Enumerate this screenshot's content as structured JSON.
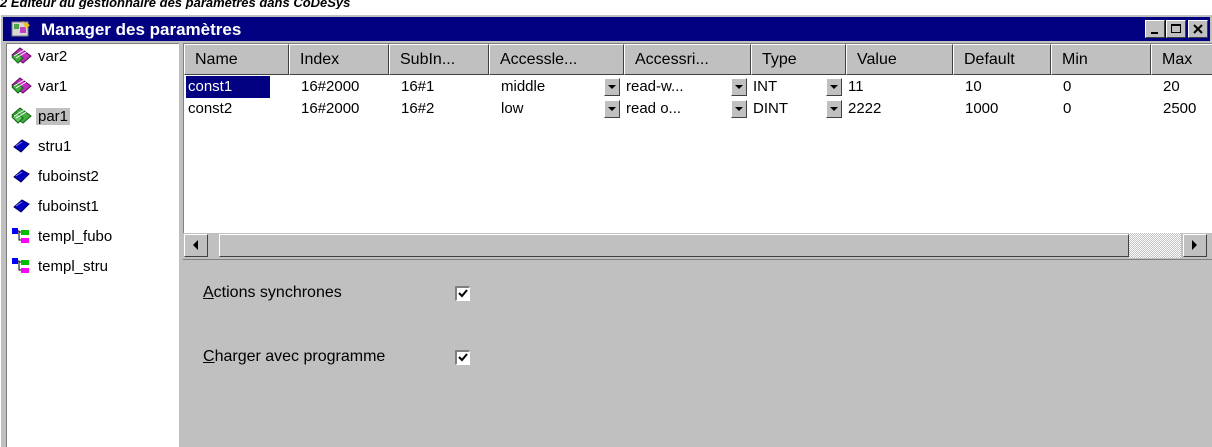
{
  "caption": "2 Editeur du gestionnaire des paramètres dans CoDeSys",
  "window": {
    "title": "Manager des paramètres"
  },
  "tree": [
    {
      "label": "var2",
      "icon": "green-purple-list-icon",
      "selected": false
    },
    {
      "label": "var1",
      "icon": "green-purple-list-icon",
      "selected": false
    },
    {
      "label": "par1",
      "icon": "green-list-icon",
      "selected": true
    },
    {
      "label": "stru1",
      "icon": "blue-diamond-icon",
      "selected": false
    },
    {
      "label": "fuboinst2",
      "icon": "blue-diamond-icon",
      "selected": false
    },
    {
      "label": "fuboinst1",
      "icon": "blue-diamond-icon",
      "selected": false
    },
    {
      "label": "templ_fubo",
      "icon": "template-icon",
      "selected": false
    },
    {
      "label": "templ_stru",
      "icon": "template-icon",
      "selected": false
    }
  ],
  "grid": {
    "columns": [
      "Name",
      "Index",
      "SubIn...",
      "Accessle...",
      "Accessri...",
      "Type",
      "Value",
      "Default",
      "Min",
      "Max"
    ],
    "rows": [
      {
        "name": "const1",
        "index": "16#2000",
        "subindex": "16#1",
        "accesslevel": "middle",
        "accessright": "read-w...",
        "type": "INT",
        "value": "11",
        "default": "10",
        "min": "0",
        "max": "20"
      },
      {
        "name": "const2",
        "index": "16#2000",
        "subindex": "16#2",
        "accesslevel": "low",
        "accessright": "read o...",
        "type": "DINT",
        "value": "2222",
        "default": "1000",
        "min": "0",
        "max": "2500"
      }
    ]
  },
  "properties": {
    "sync_actions": {
      "underline": "A",
      "rest": "ctions synchrones",
      "checked": true
    },
    "load_with_program": {
      "underline": "C",
      "rest": "harger avec programme",
      "checked": true
    }
  },
  "colors": {
    "title_bar": "#000080",
    "selection": "#000080",
    "face": "#c0c0c0"
  }
}
